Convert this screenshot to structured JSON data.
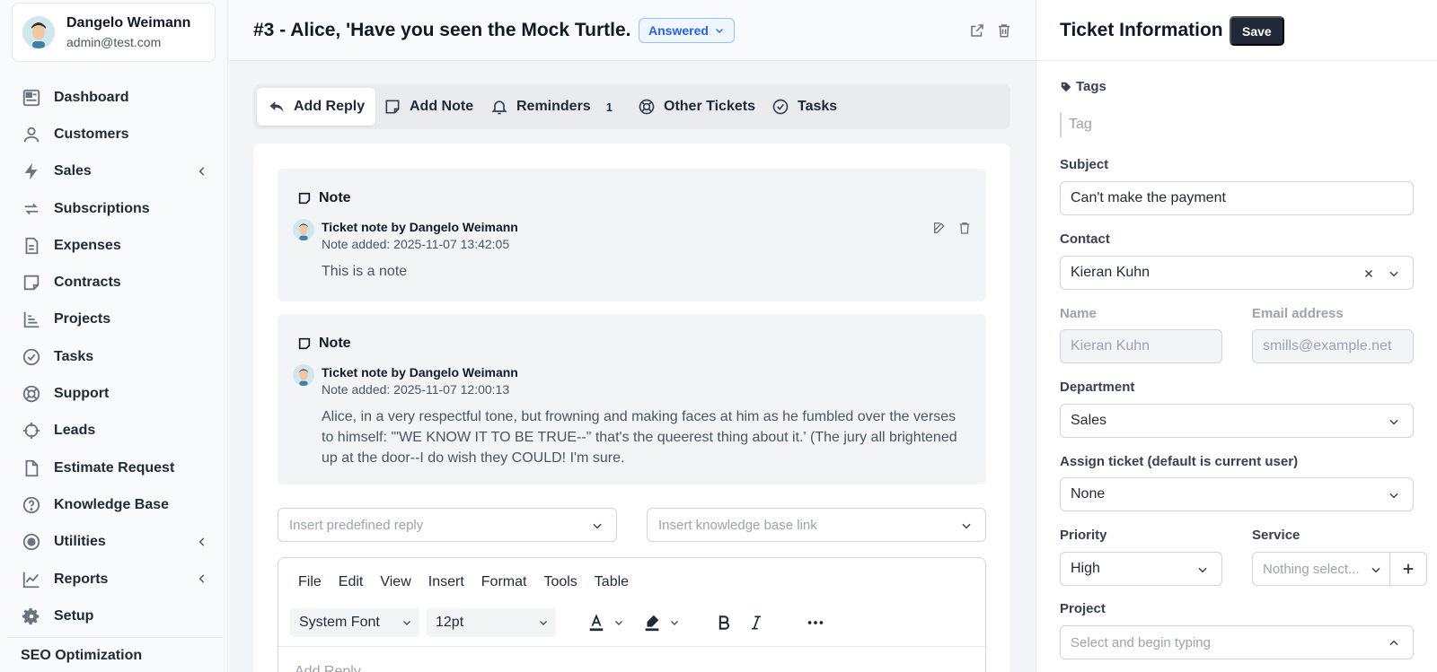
{
  "user": {
    "name": "Dangelo Weimann",
    "email": "admin@test.com"
  },
  "sidebar": {
    "items": [
      {
        "label": "Dashboard",
        "icon": "dashboard-icon",
        "chevron": false
      },
      {
        "label": "Customers",
        "icon": "user-icon",
        "chevron": false
      },
      {
        "label": "Sales",
        "icon": "bolt-icon",
        "chevron": true
      },
      {
        "label": "Subscriptions",
        "icon": "refresh-icon",
        "chevron": false
      },
      {
        "label": "Expenses",
        "icon": "document-icon",
        "chevron": false
      },
      {
        "label": "Contracts",
        "icon": "note-icon",
        "chevron": false
      },
      {
        "label": "Projects",
        "icon": "chart-bars-icon",
        "chevron": false
      },
      {
        "label": "Tasks",
        "icon": "check-circle-icon",
        "chevron": false
      },
      {
        "label": "Support",
        "icon": "lifebuoy-icon",
        "chevron": false
      },
      {
        "label": "Leads",
        "icon": "crosshair-icon",
        "chevron": false
      },
      {
        "label": "Estimate Request",
        "icon": "file-icon",
        "chevron": false
      },
      {
        "label": "Knowledge Base",
        "icon": "question-circle-icon",
        "chevron": false
      },
      {
        "label": "Utilities",
        "icon": "record-icon",
        "chevron": true
      },
      {
        "label": "Reports",
        "icon": "line-chart-icon",
        "chevron": true
      },
      {
        "label": "Setup",
        "icon": "gear-icon",
        "chevron": false
      }
    ],
    "section": "SEO Optimization"
  },
  "ticket": {
    "title": "#3 - Alice, 'Have you seen the Mock Turtle.",
    "status": "Answered"
  },
  "tabs": [
    {
      "label": "Add Reply",
      "icon": "reply-icon",
      "active": true
    },
    {
      "label": "Add Note",
      "icon": "note-icon",
      "active": false
    },
    {
      "label": "Reminders",
      "icon": "bell-icon",
      "active": false,
      "count": "1"
    },
    {
      "label": "Other Tickets",
      "icon": "lifebuoy-icon",
      "active": false
    },
    {
      "label": "Tasks",
      "icon": "check-circle-icon",
      "active": false
    }
  ],
  "notes": [
    {
      "heading": "Note",
      "by": "Ticket note by Dangelo Weimann",
      "date": "Note added: 2025-11-07 13:42:05",
      "body": "This is a note"
    },
    {
      "heading": "Note",
      "by": "Ticket note by Dangelo Weimann",
      "date": "Note added: 2025-11-07 12:00:13",
      "body": "Alice, in a very respectful tone, but frowning and making faces at him as he fumbled over the verses to himself: '\"WE KNOW IT TO BE TRUE--\" that's the queerest thing about it.' (The jury all brightened up at the door--I do wish they COULD! I'm sure."
    }
  ],
  "reply": {
    "predefined_placeholder": "Insert predefined reply",
    "kb_placeholder": "Insert knowledge base link",
    "menu": [
      "File",
      "Edit",
      "View",
      "Insert",
      "Format",
      "Tools",
      "Table"
    ],
    "font": "System Font",
    "size": "12pt",
    "placeholder": "Add Reply"
  },
  "info": {
    "title": "Ticket Information",
    "save": "Save",
    "tags_label": "Tags",
    "tag_placeholder": "Tag",
    "subject_label": "Subject",
    "subject": "Can't make the payment",
    "contact_label": "Contact",
    "contact": "Kieran Kuhn",
    "name_label": "Name",
    "name": "Kieran Kuhn",
    "email_label": "Email address",
    "email": "smills@example.net",
    "department_label": "Department",
    "department": "Sales",
    "assign_label": "Assign ticket (default is current user)",
    "assign": "None",
    "priority_label": "Priority",
    "priority": "High",
    "service_label": "Service",
    "service_placeholder": "Nothing select...",
    "project_label": "Project",
    "project_placeholder": "Select and begin typing"
  },
  "colors": {
    "accent": "#2563eb",
    "dark_button": "#1f2937",
    "sidebar_bg": "#f9fafb"
  }
}
